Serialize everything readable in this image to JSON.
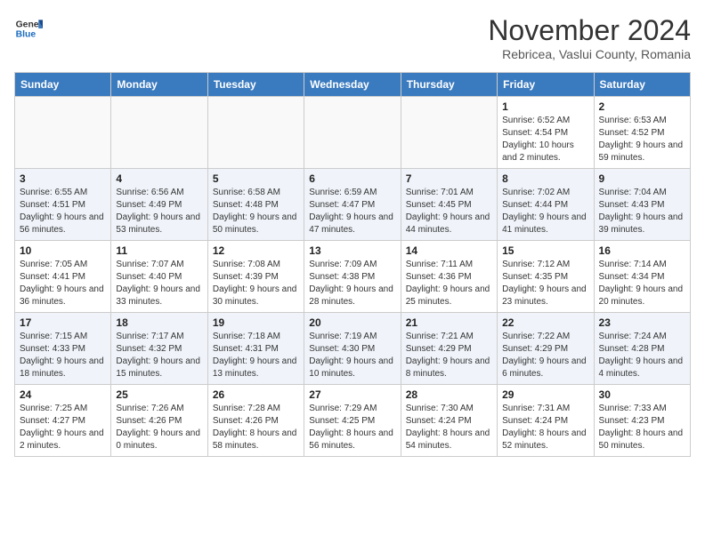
{
  "header": {
    "logo_line1": "General",
    "logo_line2": "Blue",
    "month": "November 2024",
    "location": "Rebricea, Vaslui County, Romania"
  },
  "weekdays": [
    "Sunday",
    "Monday",
    "Tuesday",
    "Wednesday",
    "Thursday",
    "Friday",
    "Saturday"
  ],
  "weeks": [
    [
      {
        "day": "",
        "info": ""
      },
      {
        "day": "",
        "info": ""
      },
      {
        "day": "",
        "info": ""
      },
      {
        "day": "",
        "info": ""
      },
      {
        "day": "",
        "info": ""
      },
      {
        "day": "1",
        "info": "Sunrise: 6:52 AM\nSunset: 4:54 PM\nDaylight: 10 hours and 2 minutes."
      },
      {
        "day": "2",
        "info": "Sunrise: 6:53 AM\nSunset: 4:52 PM\nDaylight: 9 hours and 59 minutes."
      }
    ],
    [
      {
        "day": "3",
        "info": "Sunrise: 6:55 AM\nSunset: 4:51 PM\nDaylight: 9 hours and 56 minutes."
      },
      {
        "day": "4",
        "info": "Sunrise: 6:56 AM\nSunset: 4:49 PM\nDaylight: 9 hours and 53 minutes."
      },
      {
        "day": "5",
        "info": "Sunrise: 6:58 AM\nSunset: 4:48 PM\nDaylight: 9 hours and 50 minutes."
      },
      {
        "day": "6",
        "info": "Sunrise: 6:59 AM\nSunset: 4:47 PM\nDaylight: 9 hours and 47 minutes."
      },
      {
        "day": "7",
        "info": "Sunrise: 7:01 AM\nSunset: 4:45 PM\nDaylight: 9 hours and 44 minutes."
      },
      {
        "day": "8",
        "info": "Sunrise: 7:02 AM\nSunset: 4:44 PM\nDaylight: 9 hours and 41 minutes."
      },
      {
        "day": "9",
        "info": "Sunrise: 7:04 AM\nSunset: 4:43 PM\nDaylight: 9 hours and 39 minutes."
      }
    ],
    [
      {
        "day": "10",
        "info": "Sunrise: 7:05 AM\nSunset: 4:41 PM\nDaylight: 9 hours and 36 minutes."
      },
      {
        "day": "11",
        "info": "Sunrise: 7:07 AM\nSunset: 4:40 PM\nDaylight: 9 hours and 33 minutes."
      },
      {
        "day": "12",
        "info": "Sunrise: 7:08 AM\nSunset: 4:39 PM\nDaylight: 9 hours and 30 minutes."
      },
      {
        "day": "13",
        "info": "Sunrise: 7:09 AM\nSunset: 4:38 PM\nDaylight: 9 hours and 28 minutes."
      },
      {
        "day": "14",
        "info": "Sunrise: 7:11 AM\nSunset: 4:36 PM\nDaylight: 9 hours and 25 minutes."
      },
      {
        "day": "15",
        "info": "Sunrise: 7:12 AM\nSunset: 4:35 PM\nDaylight: 9 hours and 23 minutes."
      },
      {
        "day": "16",
        "info": "Sunrise: 7:14 AM\nSunset: 4:34 PM\nDaylight: 9 hours and 20 minutes."
      }
    ],
    [
      {
        "day": "17",
        "info": "Sunrise: 7:15 AM\nSunset: 4:33 PM\nDaylight: 9 hours and 18 minutes."
      },
      {
        "day": "18",
        "info": "Sunrise: 7:17 AM\nSunset: 4:32 PM\nDaylight: 9 hours and 15 minutes."
      },
      {
        "day": "19",
        "info": "Sunrise: 7:18 AM\nSunset: 4:31 PM\nDaylight: 9 hours and 13 minutes."
      },
      {
        "day": "20",
        "info": "Sunrise: 7:19 AM\nSunset: 4:30 PM\nDaylight: 9 hours and 10 minutes."
      },
      {
        "day": "21",
        "info": "Sunrise: 7:21 AM\nSunset: 4:29 PM\nDaylight: 9 hours and 8 minutes."
      },
      {
        "day": "22",
        "info": "Sunrise: 7:22 AM\nSunset: 4:29 PM\nDaylight: 9 hours and 6 minutes."
      },
      {
        "day": "23",
        "info": "Sunrise: 7:24 AM\nSunset: 4:28 PM\nDaylight: 9 hours and 4 minutes."
      }
    ],
    [
      {
        "day": "24",
        "info": "Sunrise: 7:25 AM\nSunset: 4:27 PM\nDaylight: 9 hours and 2 minutes."
      },
      {
        "day": "25",
        "info": "Sunrise: 7:26 AM\nSunset: 4:26 PM\nDaylight: 9 hours and 0 minutes."
      },
      {
        "day": "26",
        "info": "Sunrise: 7:28 AM\nSunset: 4:26 PM\nDaylight: 8 hours and 58 minutes."
      },
      {
        "day": "27",
        "info": "Sunrise: 7:29 AM\nSunset: 4:25 PM\nDaylight: 8 hours and 56 minutes."
      },
      {
        "day": "28",
        "info": "Sunrise: 7:30 AM\nSunset: 4:24 PM\nDaylight: 8 hours and 54 minutes."
      },
      {
        "day": "29",
        "info": "Sunrise: 7:31 AM\nSunset: 4:24 PM\nDaylight: 8 hours and 52 minutes."
      },
      {
        "day": "30",
        "info": "Sunrise: 7:33 AM\nSunset: 4:23 PM\nDaylight: 8 hours and 50 minutes."
      }
    ]
  ]
}
